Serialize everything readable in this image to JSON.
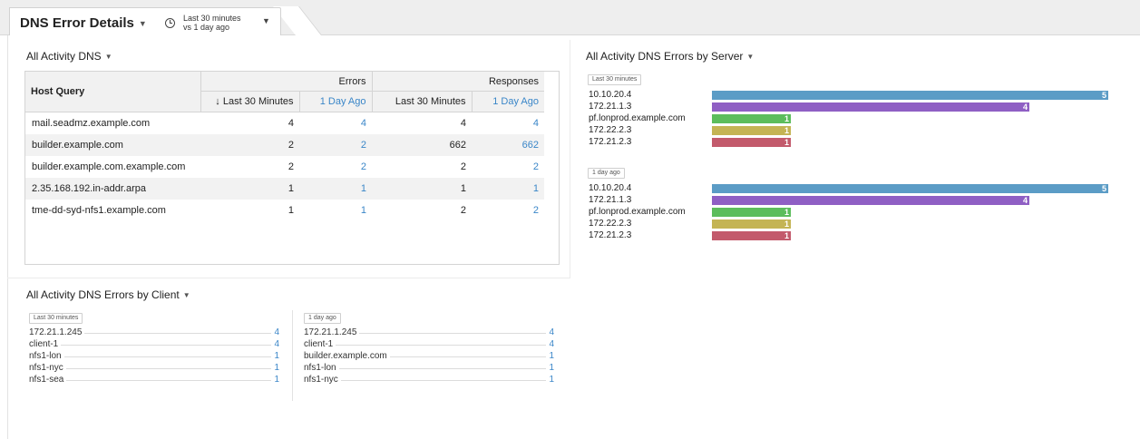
{
  "header": {
    "dashboard_title": "DNS Error Details",
    "time_range_line1": "Last 30 minutes",
    "time_range_line2": "vs 1 day ago"
  },
  "activity_table": {
    "title": "All Activity DNS",
    "col_host": "Host Query",
    "group_errors": "Errors",
    "group_responses": "Responses",
    "sub_last30": "↓ Last 30 Minutes",
    "sub_1day": "1 Day Ago",
    "sub_resp_last30": "Last 30 Minutes",
    "sub_resp_1day": "1 Day Ago",
    "rows": [
      {
        "host": "mail.seadmz.example.com",
        "err_now": "4",
        "err_prev": "4",
        "resp_now": "4",
        "resp_prev": "4"
      },
      {
        "host": "builder.example.com",
        "err_now": "2",
        "err_prev": "2",
        "resp_now": "662",
        "resp_prev": "662"
      },
      {
        "host": "builder.example.com.example.com",
        "err_now": "2",
        "err_prev": "2",
        "resp_now": "2",
        "resp_prev": "2"
      },
      {
        "host": "2.35.168.192.in-addr.arpa",
        "err_now": "1",
        "err_prev": "1",
        "resp_now": "1",
        "resp_prev": "1"
      },
      {
        "host": "tme-dd-syd-nfs1.example.com",
        "err_now": "1",
        "err_prev": "1",
        "resp_now": "2",
        "resp_prev": "2"
      }
    ]
  },
  "server_errors": {
    "title": "All Activity DNS Errors by Server",
    "groups": [
      {
        "range_label": "Last 30 minutes",
        "bars": [
          {
            "label": "10.10.20.4",
            "value": 5,
            "color": "#5b9cc6"
          },
          {
            "label": "172.21.1.3",
            "value": 4,
            "color": "#8f5fc4"
          },
          {
            "label": "pf.lonprod.example.com",
            "value": 1,
            "color": "#5cbd5c"
          },
          {
            "label": "172.22.2.3",
            "value": 1,
            "color": "#c4b454"
          },
          {
            "label": "172.21.2.3",
            "value": 1,
            "color": "#c35a6c"
          }
        ]
      },
      {
        "range_label": "1 day ago",
        "bars": [
          {
            "label": "10.10.20.4",
            "value": 5,
            "color": "#5b9cc6"
          },
          {
            "label": "172.21.1.3",
            "value": 4,
            "color": "#8f5fc4"
          },
          {
            "label": "pf.lonprod.example.com",
            "value": 1,
            "color": "#5cbd5c"
          },
          {
            "label": "172.22.2.3",
            "value": 1,
            "color": "#c4b454"
          },
          {
            "label": "172.21.2.3",
            "value": 1,
            "color": "#c35a6c"
          }
        ]
      }
    ]
  },
  "client_errors": {
    "title": "All Activity DNS Errors by Client",
    "columns": [
      {
        "range_label": "Last 30 minutes",
        "items": [
          {
            "name": "172.21.1.245",
            "value": "4"
          },
          {
            "name": "client-1",
            "value": "4"
          },
          {
            "name": "nfs1-lon",
            "value": "1"
          },
          {
            "name": "nfs1-nyc",
            "value": "1"
          },
          {
            "name": "nfs1-sea",
            "value": "1"
          }
        ]
      },
      {
        "range_label": "1 day ago",
        "items": [
          {
            "name": "172.21.1.245",
            "value": "4"
          },
          {
            "name": "client-1",
            "value": "4"
          },
          {
            "name": "builder.example.com",
            "value": "1"
          },
          {
            "name": "nfs1-lon",
            "value": "1"
          },
          {
            "name": "nfs1-nyc",
            "value": "1"
          }
        ]
      }
    ]
  }
}
